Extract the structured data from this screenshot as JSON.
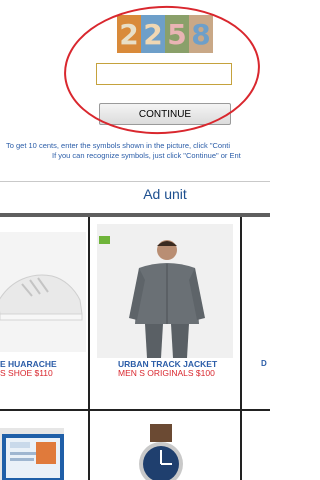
{
  "captcha": {
    "digits": [
      "2",
      "2",
      "5",
      "8"
    ],
    "digit_colors": [
      "#d98a3a",
      "#6e9fc9",
      "#8aa06a",
      "#c9a887"
    ],
    "input_value": "",
    "continue_label": "CONTINUE",
    "instruction_line1": "To get 10 cents, enter the symbols shown in the picture, click \"Conti",
    "instruction_line2": "If you can recognize symbols, just click \"Continue\" or Ent"
  },
  "ad": {
    "label": "Ad unit"
  },
  "products": [
    {
      "name": "E HUARACHE",
      "price": "S SHOE $110"
    },
    {
      "name": "URBAN TRACK JACKET",
      "price": "MEN S ORIGINALS $100"
    }
  ],
  "right_sliver": {
    "name": "D",
    "price": ""
  },
  "colors": {
    "link_blue": "#2b5da8",
    "price_red": "#d9272e",
    "circle_red": "#d9272e"
  }
}
